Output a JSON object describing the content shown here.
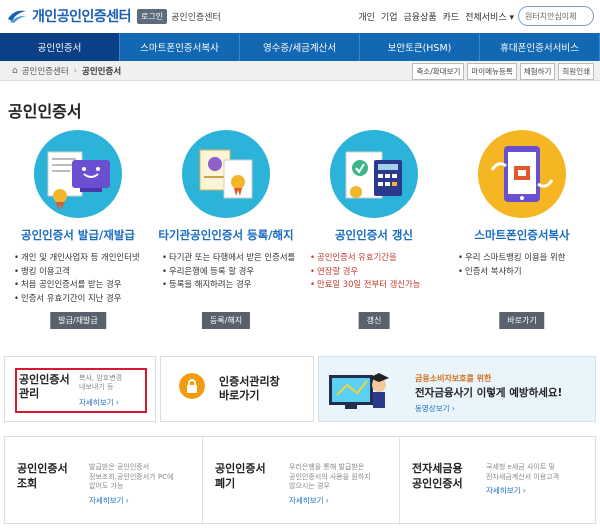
{
  "header": {
    "logo_text": "개인공인인증센터",
    "login_label": "로그인",
    "center_link": "공인인증센터",
    "util_links": [
      "개인",
      "기업",
      "금융상품",
      "카드",
      "전체서비스 ▾"
    ],
    "search_placeholder": "원터치안심이체"
  },
  "nav": {
    "items": [
      "공인인증서",
      "스마트폰인증서복사",
      "영수증/세금계산서",
      "보안토큰(HSM)",
      "휴대폰인증서서비스"
    ]
  },
  "breadcrumb": {
    "home": "공인인증센터",
    "current": "공인인증서",
    "tools": [
      "축소/확대보기",
      "마이메뉴등록",
      "체험하기",
      "회원인쇄"
    ]
  },
  "page_title": "공인인증서",
  "services": [
    {
      "title": "공인인증서 발급/재발급",
      "bullets": [
        "개인 및 개인사업자 등 개인인터넷",
        "뱅킹 이용고객",
        "처음 공인인증서를 받는 경우",
        "인증서 유효기간이 지난 경우"
      ],
      "button": "발급/재발급"
    },
    {
      "title": "타기관공인인증서 등록/해지",
      "bullets": [
        "타기관 또는 타행에서 받은 인증서를",
        "우리은행에 등록 할 경우",
        "등록을 해지하려는 경우"
      ],
      "button": "등록/해지"
    },
    {
      "title": "공인인증서 갱신",
      "bullets": [
        "공인인증서 유효기간을",
        "연장할 경우",
        "만료일 30일 전부터 갱신가능"
      ],
      "button": "갱신"
    },
    {
      "title": "스마트폰인증서복사",
      "bullets": [
        "우리 스마트뱅킹 이용을 위한",
        "인증서 복사하기"
      ],
      "button": "바로가기"
    }
  ],
  "manage_box": {
    "title_l1": "공인인증서",
    "title_l2": "관리",
    "desc_l1": "복사, 암호변경",
    "desc_l2": "내보내기 등",
    "more": "자세히보기 ›"
  },
  "store_box": {
    "title_l1": "인증서관리창",
    "title_l2": "바로가기"
  },
  "promo": {
    "sub": "금융소비자보호를 위한",
    "title": "전자금융사기 이렇게 예방하세요!",
    "more": "동영상보기 ›"
  },
  "cells": [
    {
      "t1": "공인인증서",
      "t2": "조회",
      "d": [
        "발급받은 공인인증서",
        "정보조회,공인인증서가 PC에",
        "없어도 가능"
      ],
      "more": "자세히보기 ›"
    },
    {
      "t1": "공인인증서",
      "t2": "폐기",
      "d": [
        "우리은행을 통해 발급받은",
        "공인인증서의 사용을 원하지",
        "않으시는 경우"
      ],
      "more": "자세히보기 ›"
    },
    {
      "t1": "전자세금용",
      "t2": "공인인증서",
      "d": [
        "국세청 e세금 사이트 및",
        "전자세금계산서 이용고객"
      ],
      "more": "자세히보기 ›"
    }
  ],
  "colors": {
    "brand_blue": "#1268b3",
    "nav_active": "#0b3f86",
    "link_blue": "#1a6cc0",
    "highlight_red": "#d6192e"
  }
}
